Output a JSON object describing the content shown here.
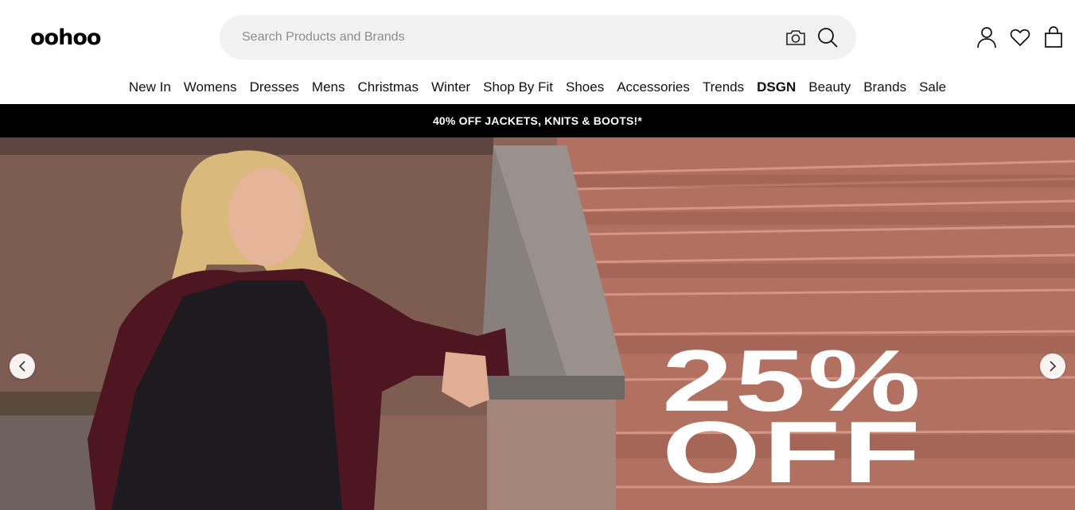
{
  "brand": {
    "logo_text": "oohoo"
  },
  "search": {
    "placeholder": "Search Products and Brands",
    "icons": [
      "camera-icon",
      "search-icon"
    ]
  },
  "header_actions": [
    "account-icon",
    "wishlist-heart-icon",
    "shopping-bag-icon"
  ],
  "nav": {
    "items": [
      {
        "label": "New In"
      },
      {
        "label": "Womens"
      },
      {
        "label": "Dresses"
      },
      {
        "label": "Mens"
      },
      {
        "label": "Christmas"
      },
      {
        "label": "Winter"
      },
      {
        "label": "Shop By Fit"
      },
      {
        "label": "Shoes"
      },
      {
        "label": "Accessories"
      },
      {
        "label": "Trends"
      },
      {
        "label": "DSGN",
        "bold": true
      },
      {
        "label": "Beauty"
      },
      {
        "label": "Brands"
      },
      {
        "label": "Sale"
      }
    ]
  },
  "promo_banner": {
    "text": "40% OFF JACKETS, KNITS & BOOTS!*"
  },
  "hero": {
    "headline_line1": "25%",
    "headline_line2": "OFF",
    "prev_icon": "chevron-left-icon",
    "next_icon": "chevron-right-icon"
  },
  "colors": {
    "promo_bg": "#000000",
    "promo_text": "#ffffff",
    "search_bg": "#f2f2f2",
    "hero_text": "#ffffff"
  }
}
